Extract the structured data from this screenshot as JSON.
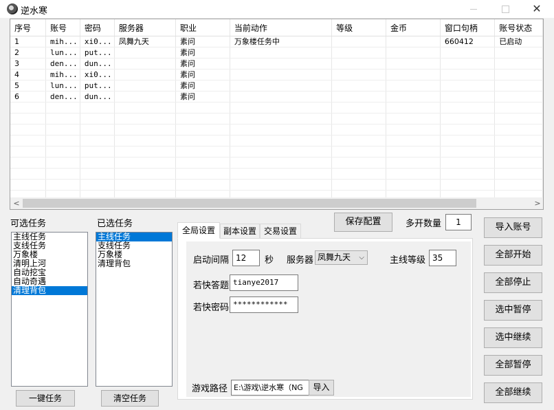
{
  "window": {
    "title": "逆水寒",
    "close_glyph": "✕"
  },
  "table": {
    "columns": [
      "序号",
      "账号",
      "密码",
      "服务器",
      "职业",
      "当前动作",
      "等级",
      "金币",
      "窗口句柄",
      "账号状态"
    ],
    "rows": [
      [
        "1",
        "mih...",
        "xi0...",
        "凤舞九天",
        "素问",
        "万象楼任务中",
        "",
        "",
        "660412",
        "已启动"
      ],
      [
        "2",
        "lun...",
        "put...",
        "",
        "素问",
        "",
        "",
        "",
        "",
        ""
      ],
      [
        "3",
        "den...",
        "dun...",
        "",
        "素问",
        "",
        "",
        "",
        "",
        ""
      ],
      [
        "4",
        "mih...",
        "xi0...",
        "",
        "素问",
        "",
        "",
        "",
        "",
        ""
      ],
      [
        "5",
        "lun...",
        "put...",
        "",
        "素问",
        "",
        "",
        "",
        "",
        ""
      ],
      [
        "6",
        "den...",
        "dun...",
        "",
        "素问",
        "",
        "",
        "",
        "",
        ""
      ]
    ],
    "empty_rows": 9,
    "scroll_left": "<",
    "scroll_right": ">"
  },
  "available_tasks": {
    "label": "可选任务",
    "items": [
      "主线任务",
      "支线任务",
      "万象楼",
      "清明上河",
      "自动挖宝",
      "自动奇遇",
      "清理背包"
    ],
    "selected_index": 6,
    "button": "一键任务"
  },
  "selected_tasks": {
    "label": "已选任务",
    "items": [
      "主线任务",
      "支线任务",
      "万象楼",
      "清理背包"
    ],
    "selected_index": 0,
    "button": "清空任务"
  },
  "config": {
    "save_button": "保存配置",
    "open_count_label": "多开数量",
    "open_count_value": "1"
  },
  "tabs": [
    "全局设置",
    "副本设置",
    "交易设置"
  ],
  "active_tab": 0,
  "global_settings": {
    "interval_label": "启动间隔",
    "interval_value": "12",
    "interval_unit": "秒",
    "server_label": "服务器",
    "server_value": "凤舞九天",
    "main_level_label": "主线等级",
    "main_level_value": "35",
    "captcha_user_label": "若快答题",
    "captcha_user_value": "tianye2017",
    "captcha_pass_label": "若快密码",
    "captcha_pass_value": "************",
    "game_path_label": "游戏路径",
    "game_path_value": "E:\\游戏\\逆水寒（NG",
    "import_path_button": "导入"
  },
  "right_buttons": [
    "导入账号",
    "全部开始",
    "全部停止",
    "选中暂停",
    "选中继续",
    "全部暂停",
    "全部继续"
  ]
}
